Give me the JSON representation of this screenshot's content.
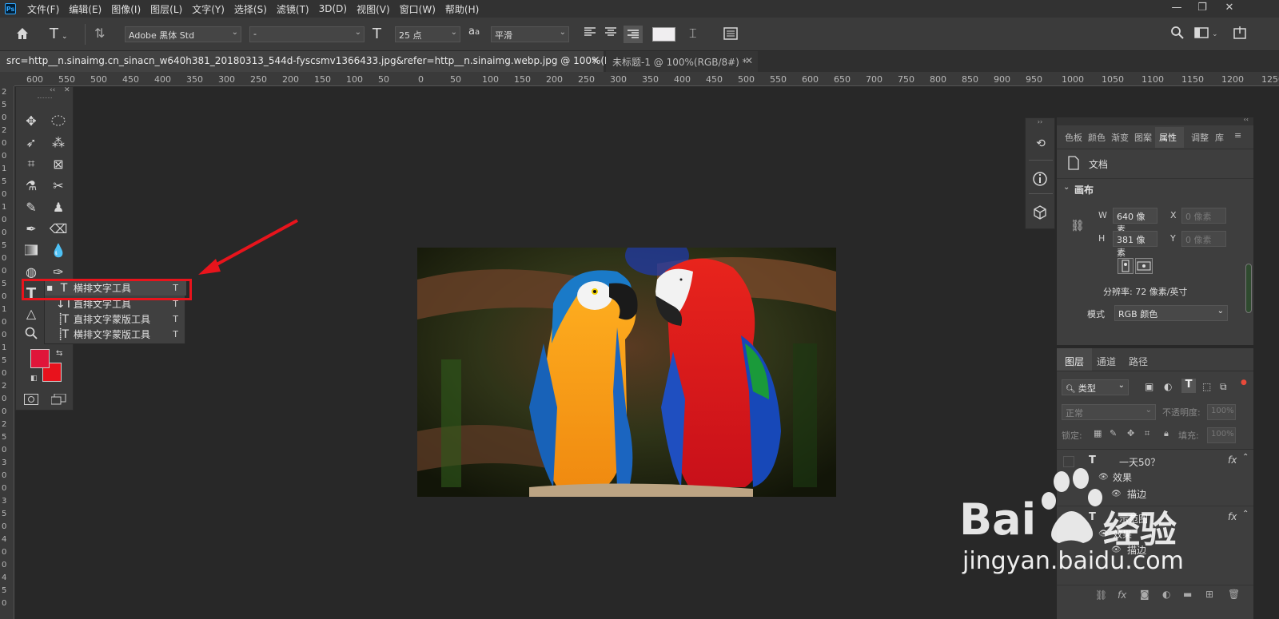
{
  "app": {
    "logo": "Ps",
    "menu": [
      "文件(F)",
      "编辑(E)",
      "图像(I)",
      "图层(L)",
      "文字(Y)",
      "选择(S)",
      "滤镜(T)",
      "3D(D)",
      "视图(V)",
      "窗口(W)",
      "帮助(H)"
    ]
  },
  "options": {
    "font_family": "Adobe 黑体 Std",
    "font_style": "-",
    "font_size": "25 点",
    "aa_icon_text": "a",
    "aa_icon_text2": "a",
    "anti_alias": "平滑"
  },
  "tabs": [
    {
      "label": "src=http__n.sinaimg.cn_sinacn_w640h381_20180313_544d-fyscsmv1366433.jpg&refer=http__n.sinaimg.webp.jpg @ 100%(RGB/8#) *",
      "active": true
    },
    {
      "label": "未标题-1 @ 100%(RGB/8#) *",
      "active": false
    }
  ],
  "ruler": {
    "h_ticks": [
      "600",
      "550",
      "500",
      "450",
      "400",
      "350",
      "300",
      "250",
      "200",
      "150",
      "100",
      "50",
      "0",
      "50",
      "100",
      "150",
      "200",
      "250",
      "300",
      "350",
      "400",
      "450",
      "500",
      "550",
      "600",
      "650",
      "700",
      "750",
      "800",
      "850",
      "900",
      "950",
      "1000",
      "1050",
      "1100",
      "1150",
      "1200",
      "1250"
    ],
    "v_ticks": [
      "2",
      "5",
      "0",
      "2",
      "0",
      "0",
      "1",
      "5",
      "0",
      "1",
      "0",
      "0",
      "5",
      "0",
      "0",
      "5",
      "0",
      "1",
      "0",
      "0",
      "1",
      "5",
      "0",
      "2",
      "0",
      "0",
      "2",
      "5",
      "0",
      "3",
      "0",
      "0",
      "3",
      "5",
      "0",
      "4",
      "0",
      "0",
      "4",
      "5",
      "0"
    ]
  },
  "flyout": {
    "items": [
      {
        "label": "横排文字工具",
        "key": "T",
        "selected": true
      },
      {
        "label": "直排文字工具",
        "key": "T",
        "selected": false
      },
      {
        "label": "直排文字蒙版工具",
        "key": "T",
        "selected": false
      },
      {
        "label": "横排文字蒙版工具",
        "key": "T",
        "selected": false
      }
    ]
  },
  "colors": {
    "foreground": "#e0153a",
    "background": "#e8121c",
    "highlight_box": "#e8141c",
    "arrow": "#e8141c"
  },
  "properties": {
    "tabs": [
      "色板",
      "颜色",
      "渐变",
      "图案",
      "属性",
      "调整",
      "库"
    ],
    "active_tab": "属性",
    "doc_label": "文档",
    "canvas_label": "画布",
    "w_label": "W",
    "w_value": "640 像素",
    "h_label": "H",
    "h_value": "381 像素",
    "x_label": "X",
    "x_value": "0 像素",
    "y_label": "Y",
    "y_value": "0 像素",
    "resolution": "分辨率: 72 像素/英寸",
    "mode_label": "模式",
    "mode_value": "RGB 颜色"
  },
  "layers": {
    "tabs": [
      "图层",
      "通道",
      "路径"
    ],
    "filter": "类型",
    "blend_mode": "正常",
    "opacity_label": "不透明度:",
    "opacity_value": "100%",
    "lock_label": "锁定:",
    "fill_label": "填充:",
    "fill_value": "100%",
    "items": [
      {
        "name": "一天50？",
        "fx": "fx",
        "effects_label": "效果",
        "stroke_label": "描边"
      },
      {
        "name": "示范图",
        "fx": "fx",
        "effects_label": "效果",
        "stroke_label": "描边"
      }
    ]
  },
  "watermark": {
    "brand": "Bai",
    "brand2": "经验",
    "url": "jingyan.baidu.com"
  }
}
